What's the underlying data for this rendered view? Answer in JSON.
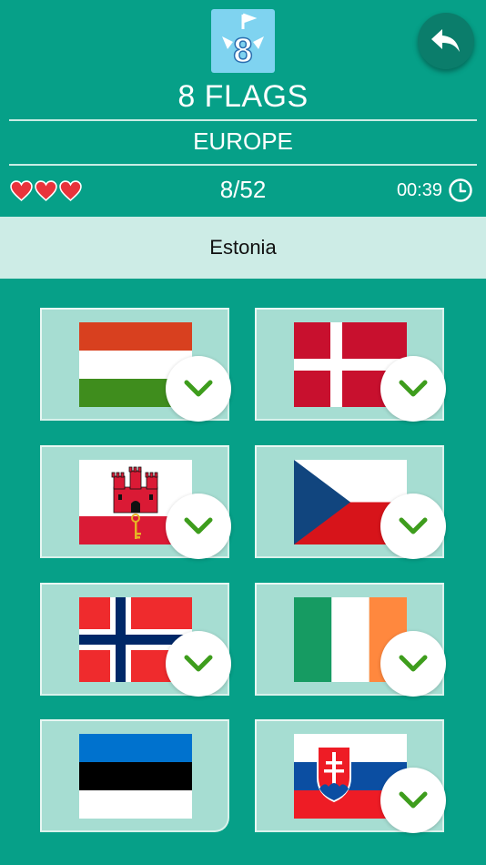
{
  "app": {
    "logo_glyph": "8",
    "title": "8 FLAGS",
    "region": "EUROPE"
  },
  "status": {
    "lives": 3,
    "progress": "8/52",
    "timer": "00:39"
  },
  "question": {
    "country": "Estonia"
  },
  "colors": {
    "background": "#06a088",
    "card": "#a6ddd2",
    "question_bar": "#cdece6",
    "check": "#3e9d1d",
    "heart": "#e8333b"
  },
  "flags": [
    {
      "country": "Hungary",
      "checked": true
    },
    {
      "country": "Denmark",
      "checked": true
    },
    {
      "country": "Gibraltar",
      "checked": true
    },
    {
      "country": "Czech Republic",
      "checked": true
    },
    {
      "country": "Norway",
      "checked": true
    },
    {
      "country": "Ireland",
      "checked": true
    },
    {
      "country": "Estonia",
      "checked": false
    },
    {
      "country": "Slovakia",
      "checked": true
    }
  ]
}
